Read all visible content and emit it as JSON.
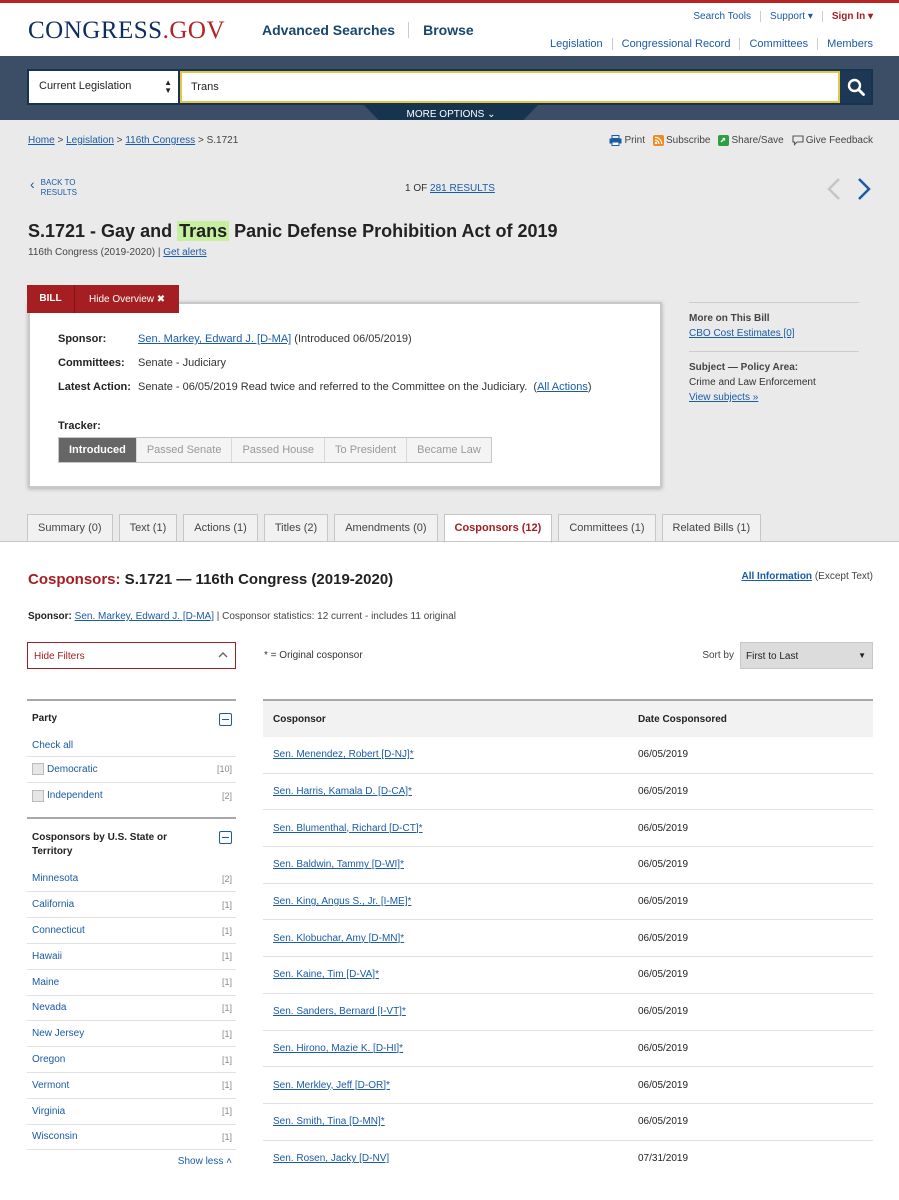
{
  "header": {
    "logo": "CONGRESS",
    "logo_tld": ".GOV",
    "main_nav": [
      "Advanced Searches",
      "Browse"
    ],
    "util_nav": [
      "Search Tools",
      "Support ▾",
      "Sign In ▾"
    ],
    "sec_nav": [
      "Legislation",
      "Congressional Record",
      "Committees",
      "Members"
    ]
  },
  "search": {
    "scope": "Current Legislation",
    "query": "Trans",
    "more_options": "MORE OPTIONS"
  },
  "breadcrumb": {
    "home": "Home",
    "legislation": "Legislation",
    "congress": "116th Congress",
    "current": "S.1721"
  },
  "tools": [
    "Print",
    "Subscribe",
    "Share/Save",
    "Give Feedback"
  ],
  "navigation": {
    "back_line1": "BACK TO",
    "back_line2": "RESULTS",
    "results_prefix": "1 OF ",
    "results_link": "281 RESULTS"
  },
  "bill": {
    "title_before": "S.1721 - Gay and ",
    "title_highlight": "Trans",
    "title_after": " Panic Defense Prohibition Act of 2019",
    "congress": "116th Congress (2019-2020)",
    "get_alerts": "Get alerts",
    "tab_bill": "BILL",
    "tab_hide": "Hide Overview ✖",
    "sponsor_label": "Sponsor:",
    "sponsor_name": "Sen. Markey, Edward J. [D-MA]",
    "sponsor_intro": "(Introduced 06/05/2019)",
    "committees_label": "Committees:",
    "committees_value": "Senate - Judiciary",
    "latest_label": "Latest Action:",
    "latest_value": "Senate - 06/05/2019 Read twice and referred to the Committee on the Judiciary.",
    "all_actions": "All Actions",
    "tracker_label": "Tracker:",
    "tracker_steps": [
      "Introduced",
      "Passed Senate",
      "Passed House",
      "To President",
      "Became Law"
    ]
  },
  "sidebar": {
    "more_heading": "More on This Bill",
    "cbo_link": "CBO Cost Estimates [0]",
    "subject_heading": "Subject — Policy Area:",
    "subject_value": "Crime and Law Enforcement",
    "view_subjects": "View subjects »"
  },
  "tabs": [
    "Summary (0)",
    "Text (1)",
    "Actions (1)",
    "Titles (2)",
    "Amendments (0)",
    "Cosponsors (12)",
    "Committees (1)",
    "Related Bills (1)"
  ],
  "content": {
    "heading_red": "Cosponsors:",
    "heading_rest": " S.1721 — 116th Congress (2019-2020)",
    "all_info": "All Information",
    "except_text": " (Except Text)",
    "sponsor_label": "Sponsor:",
    "sponsor_link": "Sen. Markey, Edward J. [D-MA]",
    "stats": " | Cosponsor statistics: 12 current - includes 11 original",
    "hide_filters": "Hide Filters",
    "legend": "* = Original cosponsor",
    "sort_label": "Sort by",
    "sort_value": "First to Last"
  },
  "filters": {
    "party_heading": "Party",
    "check_all": "Check all",
    "party_items": [
      {
        "name": "Democratic",
        "count": "[10]"
      },
      {
        "name": "Independent",
        "count": "[2]"
      }
    ],
    "state_heading": "Cosponsors by U.S. State or Territory",
    "states": [
      {
        "name": "Minnesota",
        "count": "[2]"
      },
      {
        "name": "California",
        "count": "[1]"
      },
      {
        "name": "Connecticut",
        "count": "[1]"
      },
      {
        "name": "Hawaii",
        "count": "[1]"
      },
      {
        "name": "Maine",
        "count": "[1]"
      },
      {
        "name": "Nevada",
        "count": "[1]"
      },
      {
        "name": "New Jersey",
        "count": "[1]"
      },
      {
        "name": "Oregon",
        "count": "[1]"
      },
      {
        "name": "Vermont",
        "count": "[1]"
      },
      {
        "name": "Virginia",
        "count": "[1]"
      },
      {
        "name": "Wisconsin",
        "count": "[1]"
      }
    ],
    "show_less": "Show less ˄"
  },
  "cosponsors": {
    "col_name": "Cosponsor",
    "col_date": "Date Cosponsored",
    "rows": [
      {
        "name": "Sen. Menendez, Robert [D-NJ]*",
        "date": "06/05/2019"
      },
      {
        "name": "Sen. Harris, Kamala D. [D-CA]*",
        "date": "06/05/2019"
      },
      {
        "name": "Sen. Blumenthal, Richard [D-CT]*",
        "date": "06/05/2019"
      },
      {
        "name": "Sen. Baldwin, Tammy [D-WI]*",
        "date": "06/05/2019"
      },
      {
        "name": "Sen. King, Angus S., Jr. [I-ME]*",
        "date": "06/05/2019"
      },
      {
        "name": "Sen. Klobuchar, Amy [D-MN]*",
        "date": "06/05/2019"
      },
      {
        "name": "Sen. Kaine, Tim [D-VA]*",
        "date": "06/05/2019"
      },
      {
        "name": "Sen. Sanders, Bernard [I-VT]*",
        "date": "06/05/2019"
      },
      {
        "name": "Sen. Hirono, Mazie K. [D-HI]*",
        "date": "06/05/2019"
      },
      {
        "name": "Sen. Merkley, Jeff [D-OR]*",
        "date": "06/05/2019"
      },
      {
        "name": "Sen. Smith, Tina [D-MN]*",
        "date": "06/05/2019"
      },
      {
        "name": "Sen. Rosen, Jacky [D-NV]",
        "date": "07/31/2019"
      }
    ]
  },
  "colors": {
    "accent_red": "#a41e22",
    "link_blue": "#1a5ba6",
    "search_band": "#3c4e66",
    "highlight": "#c6f0a0"
  }
}
